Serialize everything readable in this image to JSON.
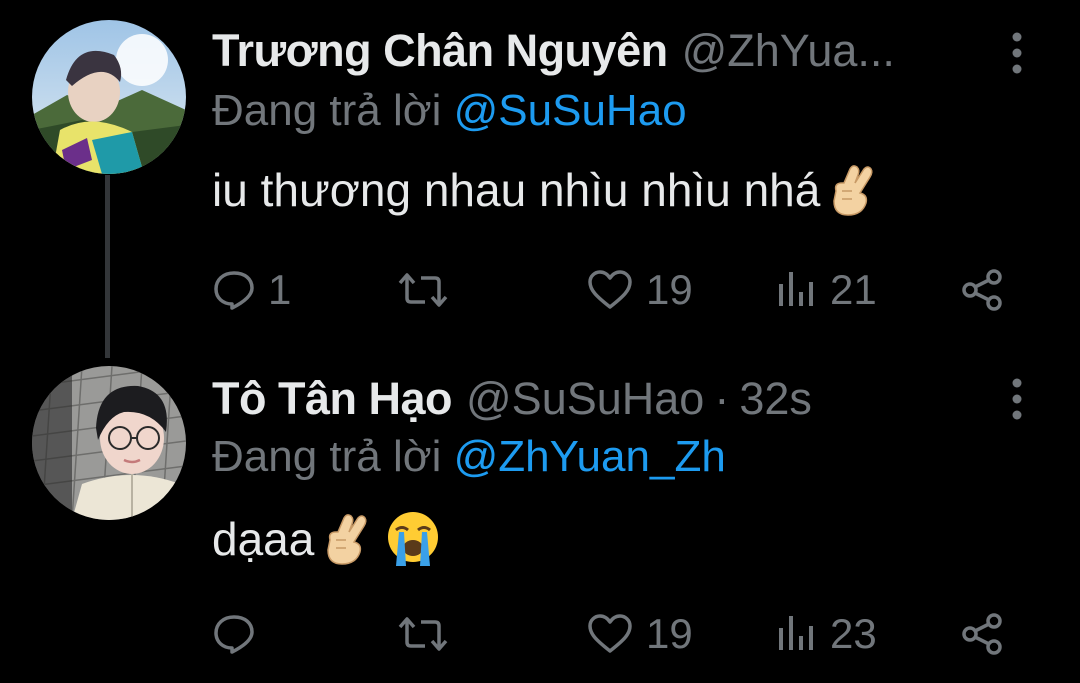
{
  "theme": {
    "background": "#000000",
    "text": "#e7e9ea",
    "muted": "#71767b",
    "link": "#1d9bf0",
    "thread_line": "#333639"
  },
  "tweets": [
    {
      "display_name": "Trương Chân Nguyên",
      "handle": "@ZhYua...",
      "replying_prefix": "Đang trả lời",
      "replying_to": "@SuSuHao",
      "text": "iu thương nhau nhìu nhìu nhá",
      "emojis": [
        "crossed-fingers-light-skin"
      ],
      "replies": "1",
      "retweets": "",
      "likes": "19",
      "views": "21",
      "avatar": "avatar-photo-outdoor"
    },
    {
      "display_name": "Tô Tân Hạo",
      "handle": "@SuSuHao",
      "separator": "·",
      "time": "32s",
      "replying_prefix": "Đang trả lời",
      "replying_to": "@ZhYuan_Zh",
      "text": "dạaa",
      "emojis": [
        "crossed-fingers-light-skin",
        "loudly-crying-face"
      ],
      "replies": "",
      "retweets": "",
      "likes": "19",
      "views": "23",
      "avatar": "avatar-photo-selfie"
    }
  ],
  "icons": {
    "reply": "reply-icon",
    "retweet": "retweet-icon",
    "like": "heart-icon",
    "views": "views-icon",
    "share": "share-icon",
    "more": "more-icon"
  }
}
